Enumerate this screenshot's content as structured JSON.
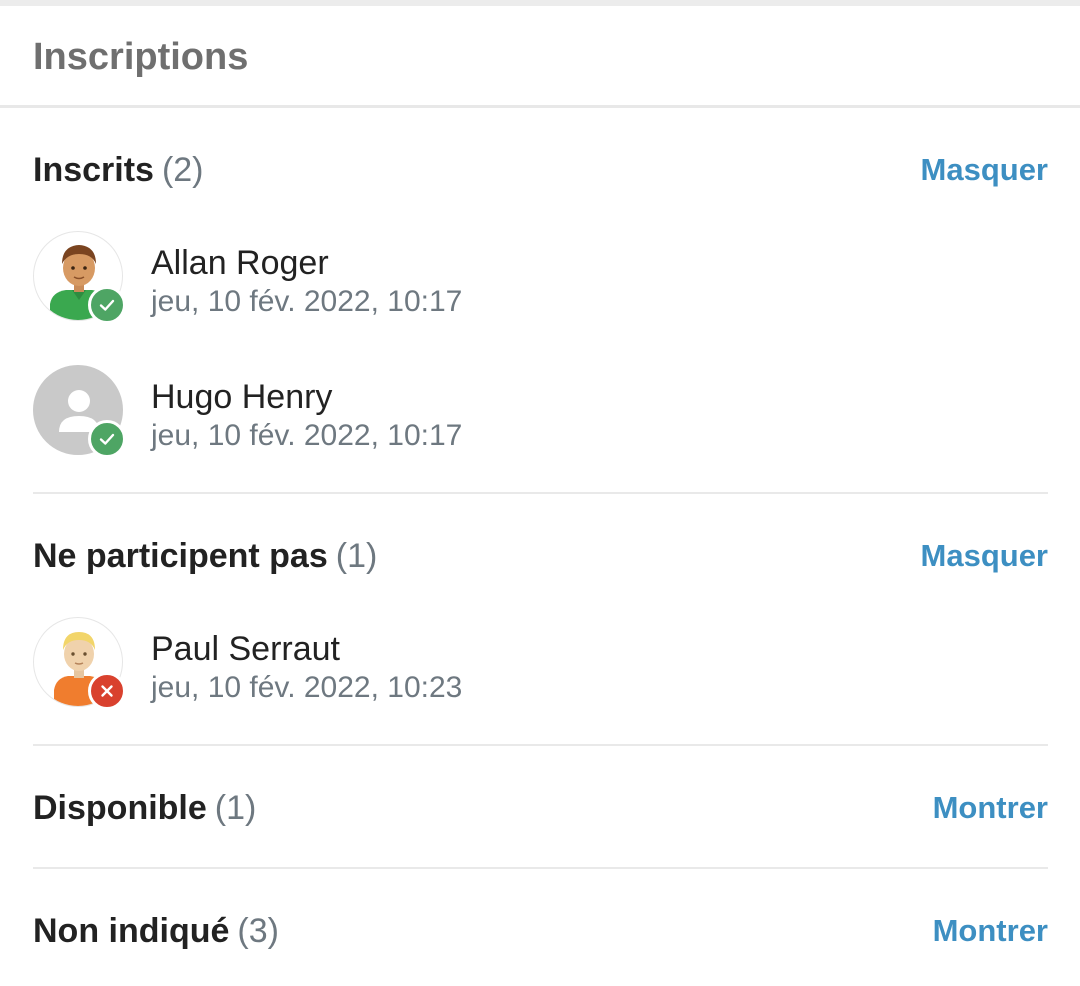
{
  "page": {
    "title": "Inscriptions"
  },
  "sections": [
    {
      "name": "Inscrits",
      "count": "(2)",
      "toggle_label": "Masquer",
      "members": [
        {
          "name": "Allan Roger",
          "date": "jeu, 10 fév. 2022, 10:17",
          "status": "accepted",
          "avatar": "avatar-green-shirt"
        },
        {
          "name": "Hugo Henry",
          "date": "jeu, 10 fév. 2022, 10:17",
          "status": "accepted",
          "avatar": "avatar-placeholder"
        }
      ]
    },
    {
      "name": "Ne participent pas",
      "count": "(1)",
      "toggle_label": "Masquer",
      "members": [
        {
          "name": "Paul Serraut",
          "date": "jeu, 10 fév. 2022, 10:23",
          "status": "declined",
          "avatar": "avatar-orange-shirt"
        }
      ]
    },
    {
      "name": "Disponible",
      "count": "(1)",
      "toggle_label": "Montrer",
      "members": []
    },
    {
      "name": "Non indiqué",
      "count": "(3)",
      "toggle_label": "Montrer",
      "members": []
    }
  ],
  "colors": {
    "link": "#3d8fc2",
    "accepted": "#4ea564",
    "declined": "#d9412e",
    "muted_text": "#6e7880"
  },
  "icons": {
    "accepted": "check-icon",
    "declined": "close-icon"
  }
}
